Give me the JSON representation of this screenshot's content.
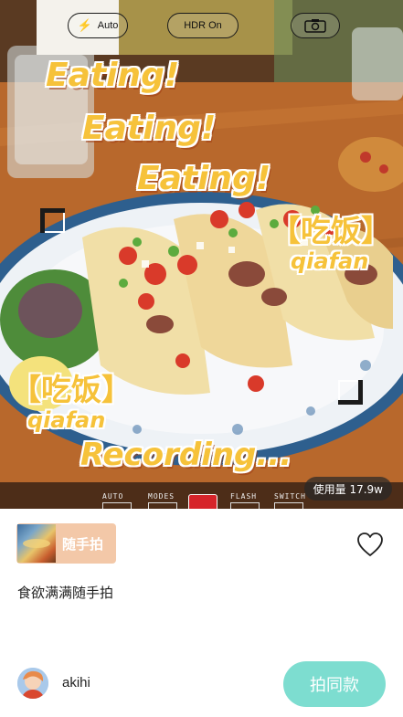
{
  "camera": {
    "flash_label": "Auto",
    "hdr_label": "HDR On",
    "switch_icon": "camera-switch-icon",
    "controls": [
      {
        "label": "AUTO"
      },
      {
        "label": "MODES"
      },
      {
        "label": "FLASH"
      },
      {
        "label": "SWITCH"
      }
    ]
  },
  "overlay": {
    "line1": "Eating!",
    "line2": "Eating!",
    "line3": "Eating!",
    "tag_cn_1": "【吃饭】",
    "tag_en_1": "qiafan",
    "tag_cn_2": "【吃饭】",
    "tag_en_2": "qiafan",
    "status": "Recording..."
  },
  "usage_badge": "使用量 17.9w",
  "template_card": {
    "label": "随手拍"
  },
  "caption": "食欲满满随手拍",
  "author": {
    "name": "akihi"
  },
  "cta": {
    "label": "拍同款"
  },
  "colors": {
    "accent": "#7dddd0",
    "overlay_text": "#f6c23a",
    "tag_card_bg": "#f3c8a8"
  }
}
